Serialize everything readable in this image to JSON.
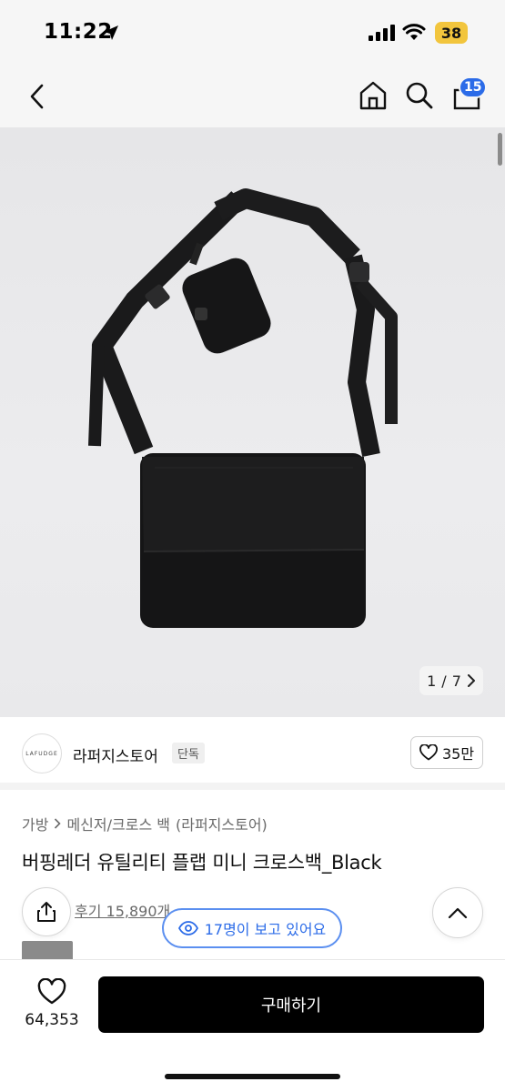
{
  "status_bar": {
    "time": "11:22",
    "battery": "38"
  },
  "header": {
    "cart_count": "15"
  },
  "gallery": {
    "current": "1",
    "separator": "/",
    "total": "7"
  },
  "store": {
    "logo_text": "LAFUDGE",
    "name": "라퍼지스토어",
    "tag": "단독",
    "likes": "35만"
  },
  "breadcrumb": [
    "가방",
    "메신저/크로스 백",
    "(라퍼지스토어)"
  ],
  "product": {
    "title": "버핑레더 유틸리티 플랩 미니 크로스백_Black",
    "review_label": "후기 15,890개",
    "viewers": "17명이 보고 있어요"
  },
  "bottom": {
    "wish_count": "64,353",
    "buy_label": "구매하기"
  },
  "colors": {
    "accent": "#2b6be8",
    "battery": "#f2c53d",
    "buy_button": "#000000"
  }
}
